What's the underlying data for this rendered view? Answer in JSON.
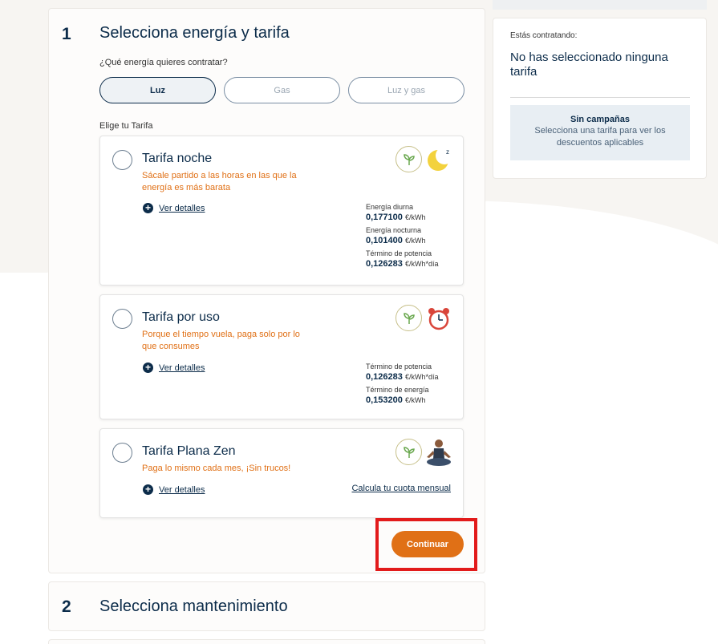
{
  "step1": {
    "number": "1",
    "title": "Selecciona energía y tarifa",
    "energy_question": "¿Qué energía quieres contratar?",
    "energy_options": [
      "Luz",
      "Gas",
      "Luz y gas"
    ],
    "energy_selected": "Luz",
    "tariff_label": "Elige tu Tarifa",
    "tariffs": [
      {
        "name": "Tarifa noche",
        "description": "Sácale partido a las horas en las que la energía es más barata",
        "details_label": "Ver detalles",
        "prices": [
          {
            "label": "Energía diurna",
            "value": "0,177100",
            "unit": "€/kWh"
          },
          {
            "label": "Energía nocturna",
            "value": "0,101400",
            "unit": "€/kWh"
          },
          {
            "label": "Término de potencia",
            "value": "0,126283",
            "unit": "€/kWh*día"
          }
        ],
        "icon": "moon-icon"
      },
      {
        "name": "Tarifa por uso",
        "description": "Porque el tiempo vuela, paga solo por lo que consumes",
        "details_label": "Ver detalles",
        "prices": [
          {
            "label": "Término de potencia",
            "value": "0,126283",
            "unit": "€/kWh*día"
          },
          {
            "label": "Término de energía",
            "value": "0,153200",
            "unit": "€/kWh"
          }
        ],
        "icon": "alarm-clock-icon"
      },
      {
        "name": "Tarifa Plana Zen",
        "description": "Paga lo mismo cada mes, ¡Sin trucos!",
        "details_label": "Ver detalles",
        "calc_link": "Calcula tu cuota mensual",
        "icon": "meditating-person-icon"
      }
    ],
    "continue_label": "Continuar"
  },
  "step2": {
    "number": "2",
    "title": "Selecciona mantenimiento"
  },
  "sidebar": {
    "subtitle": "Estás contratando:",
    "title": "No has seleccionado ninguna tarifa",
    "campaign_title": "Sin campañas",
    "campaign_text": "Selecciona una tarifa para ver los descuentos aplicables"
  },
  "colors": {
    "primary": "#0c2c4a",
    "accent": "#e07016",
    "highlight": "#e21b1b"
  }
}
